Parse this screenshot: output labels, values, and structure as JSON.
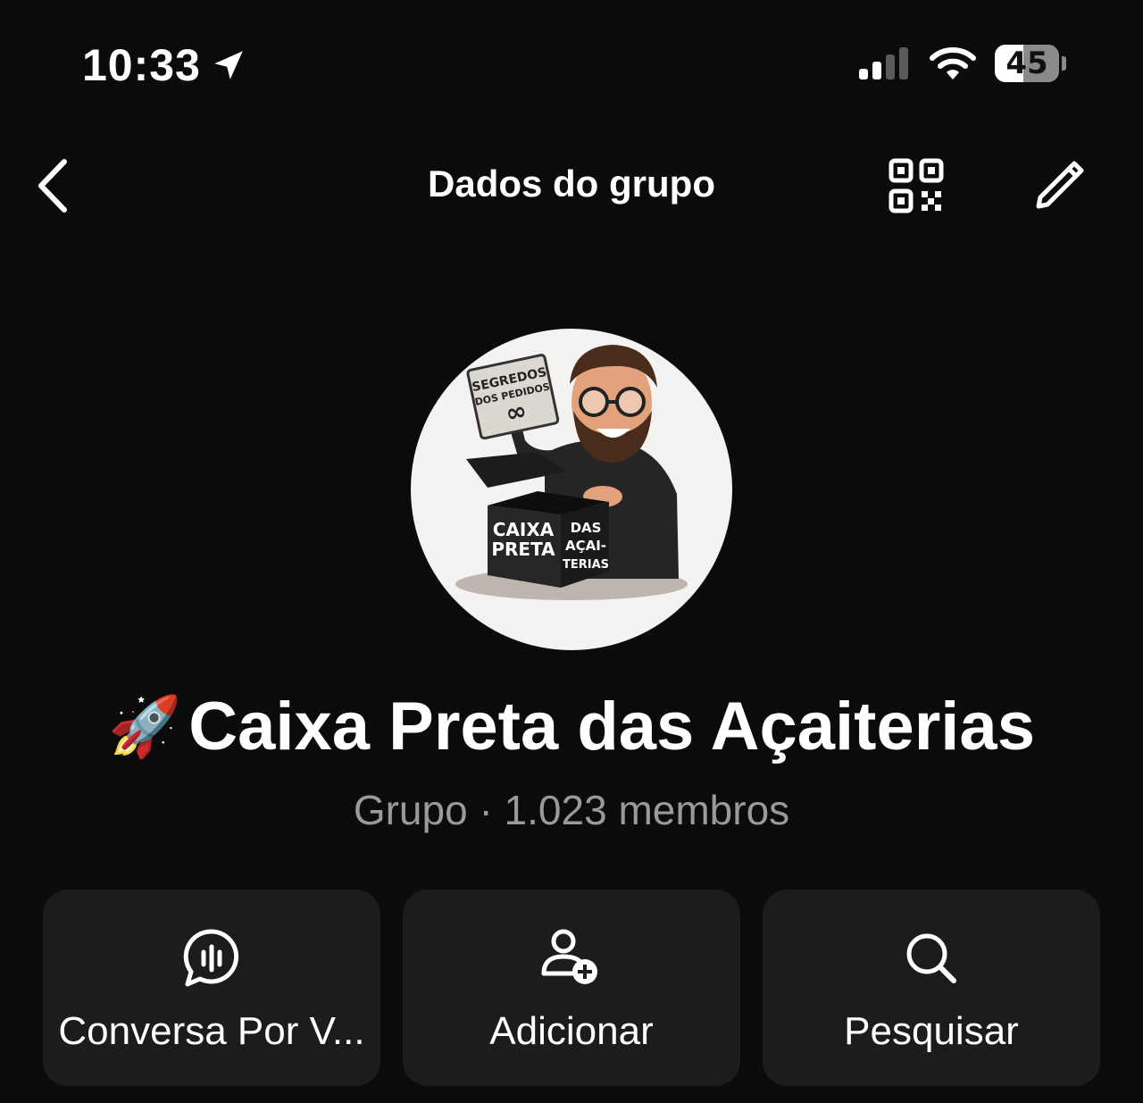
{
  "status_bar": {
    "time": "10:33",
    "battery": "45",
    "battery_level": 0.45,
    "location_icon": "location-arrow-icon",
    "signal_icon": "cellular-signal-icon",
    "wifi_icon": "wifi-icon"
  },
  "header": {
    "title": "Dados do grupo",
    "back_icon": "chevron-left-icon",
    "qr_icon": "qr-code-icon",
    "edit_icon": "pencil-icon"
  },
  "group": {
    "emoji": "🚀",
    "name": "Caixa Preta das Açaiterias",
    "meta": "Grupo · 1.023 membros",
    "avatar": {
      "sign_line1": "SEGREDOS",
      "sign_line2": "DOS PEDIDOS",
      "sign_symbol": "∞",
      "box_front_line1": "CAIXA",
      "box_front_line2": "PRETA",
      "box_side_line1": "DAS",
      "box_side_line2": "AÇAI-",
      "box_side_line3": "TERIAS"
    }
  },
  "actions": [
    {
      "label": "Conversa Por V...",
      "icon": "voice-chat-icon"
    },
    {
      "label": "Adicionar",
      "icon": "add-person-icon"
    },
    {
      "label": "Pesquisar",
      "icon": "search-icon"
    }
  ],
  "colors": {
    "background": "#0b0b0b",
    "card": "#1c1c1e",
    "text": "#ffffff",
    "secondary_text": "#9a9a9a"
  }
}
